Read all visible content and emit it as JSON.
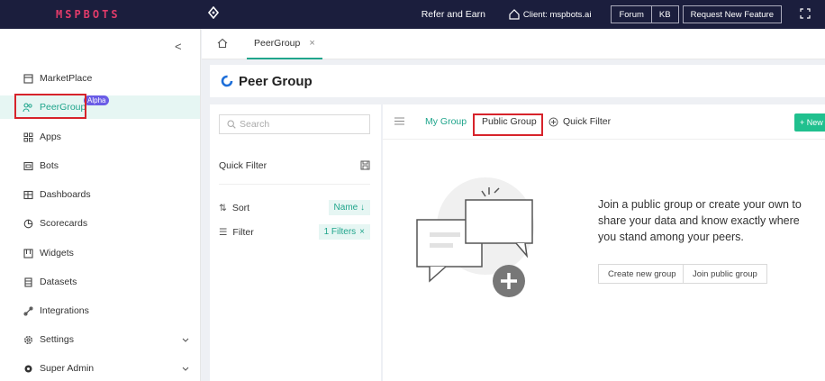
{
  "app": {
    "logo_text": "MSPBOTS",
    "brand_color": "#e23b6a",
    "accent_color": "#20a58c"
  },
  "topbar": {
    "refer": "Refer and Earn",
    "client": "Client: mspbots.ai",
    "forum": "Forum",
    "kb": "KB",
    "request": "Request New Feature"
  },
  "sidebar": {
    "collapse_glyph": "<",
    "items": [
      {
        "label": "MarketPlace",
        "icon": "store-icon"
      },
      {
        "label": "PeerGroup",
        "icon": "peer-icon",
        "badge": "Alpha",
        "active": true
      },
      {
        "label": "Apps",
        "icon": "apps-icon"
      },
      {
        "label": "Bots",
        "icon": "bot-icon"
      },
      {
        "label": "Dashboards",
        "icon": "dashboard-icon"
      },
      {
        "label": "Scorecards",
        "icon": "scorecard-icon"
      },
      {
        "label": "Widgets",
        "icon": "widget-icon"
      },
      {
        "label": "Datasets",
        "icon": "dataset-icon"
      },
      {
        "label": "Integrations",
        "icon": "integration-icon"
      },
      {
        "label": "Settings",
        "icon": "settings-icon",
        "expandable": true
      },
      {
        "label": "Super Admin",
        "icon": "admin-icon",
        "expandable": true
      }
    ]
  },
  "tabs": {
    "open_tab": "PeerGroup",
    "close_glyph": "×"
  },
  "page": {
    "title": "Peer Group"
  },
  "filters": {
    "search_placeholder": "Search",
    "quick_filter": "Quick Filter",
    "sort_label": "Sort",
    "sort_value": "Name ↓",
    "filter_label": "Filter",
    "filter_value": "1 Filters",
    "clear_glyph": "×"
  },
  "main": {
    "tab_my": "My Group",
    "tab_public": "Public Group",
    "quick_filter": "Quick Filter",
    "new_button": "+ New",
    "empty_message": "Join a public group or create your own to share your data and know exactly where you stand among your peers.",
    "create_button": "Create new group",
    "join_button": "Join public group"
  }
}
